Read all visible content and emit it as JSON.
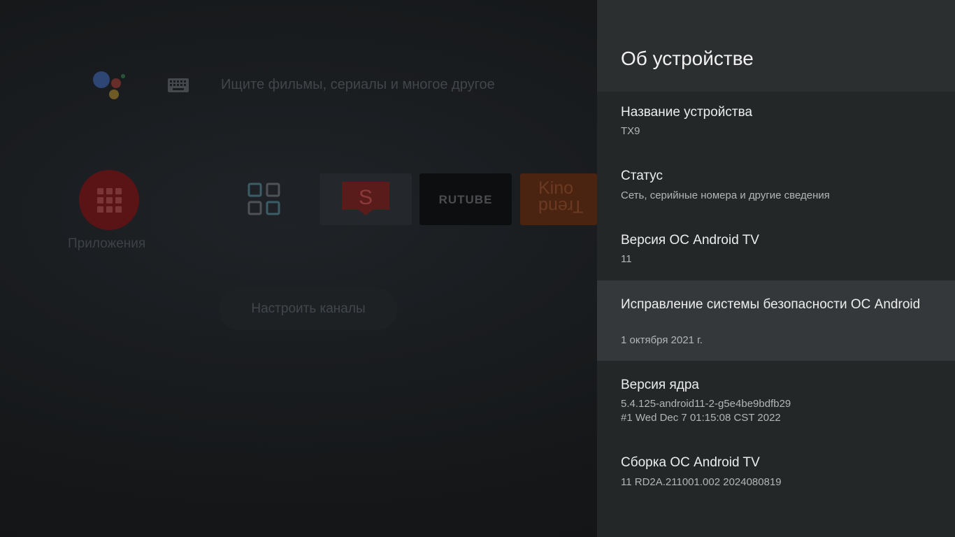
{
  "home": {
    "search_placeholder": "Ищите фильмы, сериалы и многое другое",
    "apps_label": "Приложения",
    "tiles": [
      {
        "name": "app-tile-grid",
        "icon": "four-squares-icon"
      },
      {
        "name": "app-tile-s",
        "icon": "s-tv-icon",
        "text": "S"
      },
      {
        "name": "app-tile-rutube",
        "text": "RUTUBE"
      },
      {
        "name": "app-tile-kino-trend",
        "text_line1": "Kino",
        "text_line2": "Trend"
      }
    ],
    "channels_button": "Настроить каналы"
  },
  "panel": {
    "title": "Об устройстве",
    "items": [
      {
        "title": "Название устройства",
        "sub": "TX9"
      },
      {
        "title": "Статус",
        "sub": "Сеть, серийные номера и другие сведения"
      },
      {
        "title": "Версия ОС Android TV",
        "sub": "11"
      },
      {
        "title": "Исправление системы безопасности ОС Android",
        "sub": "1 октября 2021 г."
      },
      {
        "title": "Версия ядра",
        "sub_line1": "5.4.125-android11-2-g5e4be9bdfb29",
        "sub_line2": "#1 Wed Dec 7 01:15:08 CST 2022"
      },
      {
        "title": "Сборка ОС Android TV",
        "sub": "11 RD2A.211001.002 2024080819"
      }
    ]
  },
  "colors": {
    "panel_bg": "#242728",
    "panel_header_bg": "#2c2f30",
    "focused_item_bg": "#35383a",
    "apps_red": "#5b1416"
  }
}
